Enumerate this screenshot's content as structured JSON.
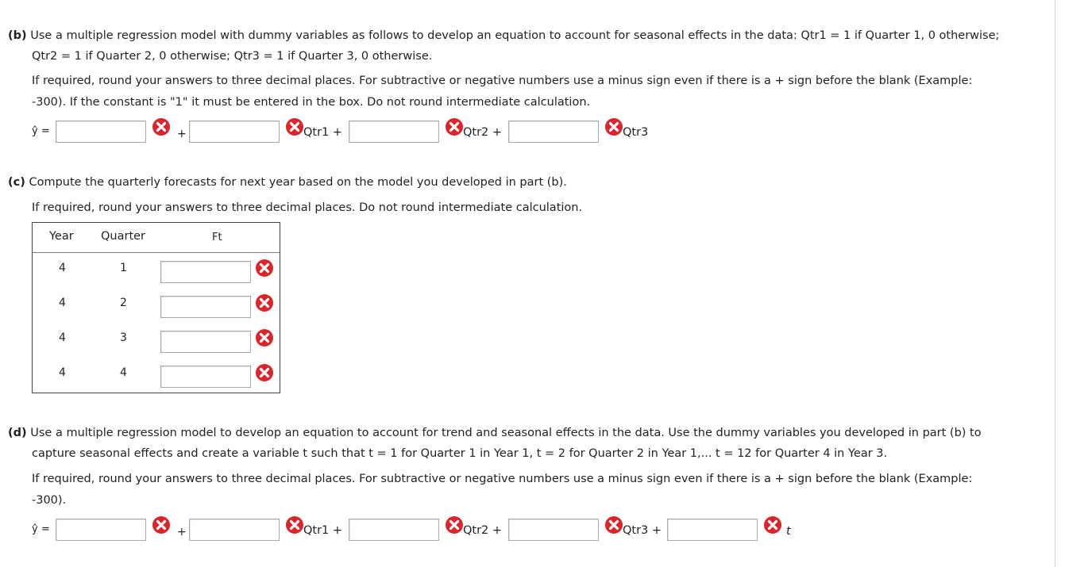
{
  "part_b": {
    "label": "(b)",
    "line1": "Use a multiple regression model with dummy variables as follows to develop an equation to account for seasonal effects in the data: Qtr1 = 1 if Quarter 1, 0 otherwise;",
    "line2": "Qtr2 = 1 if Quarter 2, 0 otherwise; Qtr3 = 1 if Quarter 3, 0 otherwise.",
    "instr1": "If required, round your answers to three decimal places. For subtractive or negative numbers use a minus sign even if there is a + sign before the blank (Example:",
    "instr2": "-300). If the constant is \"1\" it must be entered in the box. Do not round intermediate calculation.",
    "yhat": "ŷ =",
    "plus": "+",
    "qtr1": "Qtr1 +",
    "qtr2": "Qtr2 +",
    "qtr3": "Qtr3"
  },
  "part_c": {
    "label": "(c)",
    "line1": "Compute the quarterly forecasts for next year based on the model you developed in part (b).",
    "instr": "If required, round your answers to three decimal places. Do not round intermediate calculation.",
    "headers": {
      "year": "Year",
      "quarter": "Quarter",
      "ft": "Ft"
    },
    "rows": [
      {
        "year": "4",
        "quarter": "1"
      },
      {
        "year": "4",
        "quarter": "2"
      },
      {
        "year": "4",
        "quarter": "3"
      },
      {
        "year": "4",
        "quarter": "4"
      }
    ]
  },
  "part_d": {
    "label": "(d)",
    "line1_a": "Use a multiple regression model to develop an equation to account for trend and seasonal effects in the data. Use the dummy variables you developed in part (b) to",
    "line2": "capture seasonal effects and create a variable t such that t = 1 for Quarter 1 in Year 1, t = 2 for Quarter 2 in Year 1,... t = 12 for Quarter 4 in Year 3.",
    "instr1": "If required, round your answers to three decimal places. For subtractive or negative numbers use a minus sign even if there is a + sign before the blank (Example:",
    "instr2": "-300).",
    "yhat": "ŷ =",
    "plus": "+",
    "qtr1": "Qtr1 +",
    "qtr2": "Qtr2 +",
    "qtr3": "Qtr3 +",
    "t": "t"
  },
  "icons": {
    "error": "x-circle-icon"
  },
  "colors": {
    "error_red": "#d9252b",
    "error_red_dark": "#b81d22",
    "border": "#a8a8a8"
  }
}
